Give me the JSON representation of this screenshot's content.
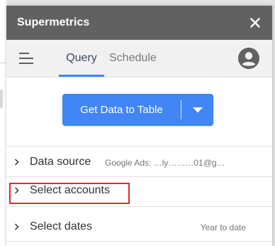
{
  "app": {
    "title": "Supermetrics"
  },
  "tabs": [
    {
      "label": "Query",
      "active": true
    },
    {
      "label": "Schedule",
      "active": false
    }
  ],
  "primary_button": {
    "label": "Get Data to Table"
  },
  "rows": [
    {
      "label": "Data source",
      "value": "Google Ads: …ly………01@g…"
    },
    {
      "label": "Select accounts",
      "value": ""
    },
    {
      "label": "Select dates",
      "value": "Year to date"
    }
  ],
  "icons": {
    "close": "close-icon",
    "menu": "menu-icon",
    "avatar": "account-circle-icon",
    "dropdown": "caret-down-icon",
    "chevron": "chevron-right-icon"
  },
  "colors": {
    "titlebar": "#616161",
    "accent": "#4285f4",
    "highlight": "#d32f2f"
  }
}
